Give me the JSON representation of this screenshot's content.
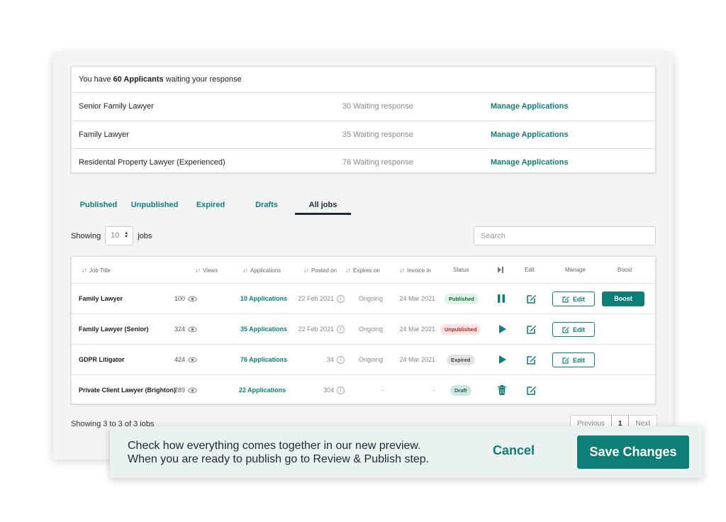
{
  "applicants": {
    "prefix": "You have ",
    "count_text": "60 Applicants",
    "suffix": " waiting your response",
    "rows": [
      {
        "title": "Senior Family Lawyer",
        "waiting": "30 Waiting response",
        "link": "Manage Applications"
      },
      {
        "title": "Family Lawyer",
        "waiting": "35 Waiting response",
        "link": "Manage Applications"
      },
      {
        "title": "Residental Property Lawyer (Experienced)",
        "waiting": "76 Waiting response",
        "link": "Manage Applications"
      }
    ]
  },
  "tabs": [
    "Published",
    "Unpublished",
    "Expired",
    "Drafts",
    "All jobs"
  ],
  "active_tab": "All jobs",
  "showing": {
    "label": "Showing",
    "value": "10",
    "suffix": "jobs"
  },
  "search": {
    "placeholder": "Search"
  },
  "table": {
    "headers": {
      "job_title": "Job Title",
      "views": "Views",
      "applications": "Applications",
      "posted": "Posted on",
      "expires": "Expires on",
      "invoice": "Invoice in",
      "status": "Status",
      "edit": "Edit",
      "manage": "Manage",
      "boost": "Boost"
    },
    "rows": [
      {
        "title": "Family Lawyer",
        "views": "100",
        "applications": "10 Applications",
        "posted": "22 Feb 2021",
        "expires": "Ongoing",
        "invoice": "24 Mar 2021",
        "status": "Published",
        "action": "pause-icon",
        "manage": "Edit",
        "boost": "Boost"
      },
      {
        "title": "Family Lawyer (Senior)",
        "views": "324",
        "applications": "35 Applications",
        "posted": "22 Feb 2021",
        "expires": "Ongoing",
        "invoice": "24 Mar 2021",
        "status": "Unpublished",
        "action": "play-icon",
        "manage": "Edit",
        "boost": ""
      },
      {
        "title": "GDPR Litigator",
        "views": "424",
        "applications": "76 Applications",
        "posted": "34",
        "expires": "Ongoing",
        "invoice": "24 Mar 2021",
        "status": "Expired",
        "action": "play-icon",
        "manage": "Edit",
        "boost": ""
      },
      {
        "title": "Private Client Lawyer (Brighton)",
        "views": "289",
        "applications": "22 Applications",
        "posted": "304",
        "expires": "-",
        "invoice": "-",
        "status": "Draft",
        "action": "trash-icon",
        "manage": "",
        "boost": ""
      }
    ]
  },
  "footer": {
    "showing_text": "Showing 3 to 3 of 3 jobs",
    "previous": "Previous",
    "page": "1",
    "next": "Next"
  },
  "bar": {
    "line1": "Check how everything comes together in our new preview.",
    "line2": "When you are ready to publish go to Review & Publish step.",
    "cancel": "Cancel",
    "save": "Save Changes"
  },
  "colors": {
    "accent": "#0e7f76",
    "dark": "#1d2a35"
  }
}
